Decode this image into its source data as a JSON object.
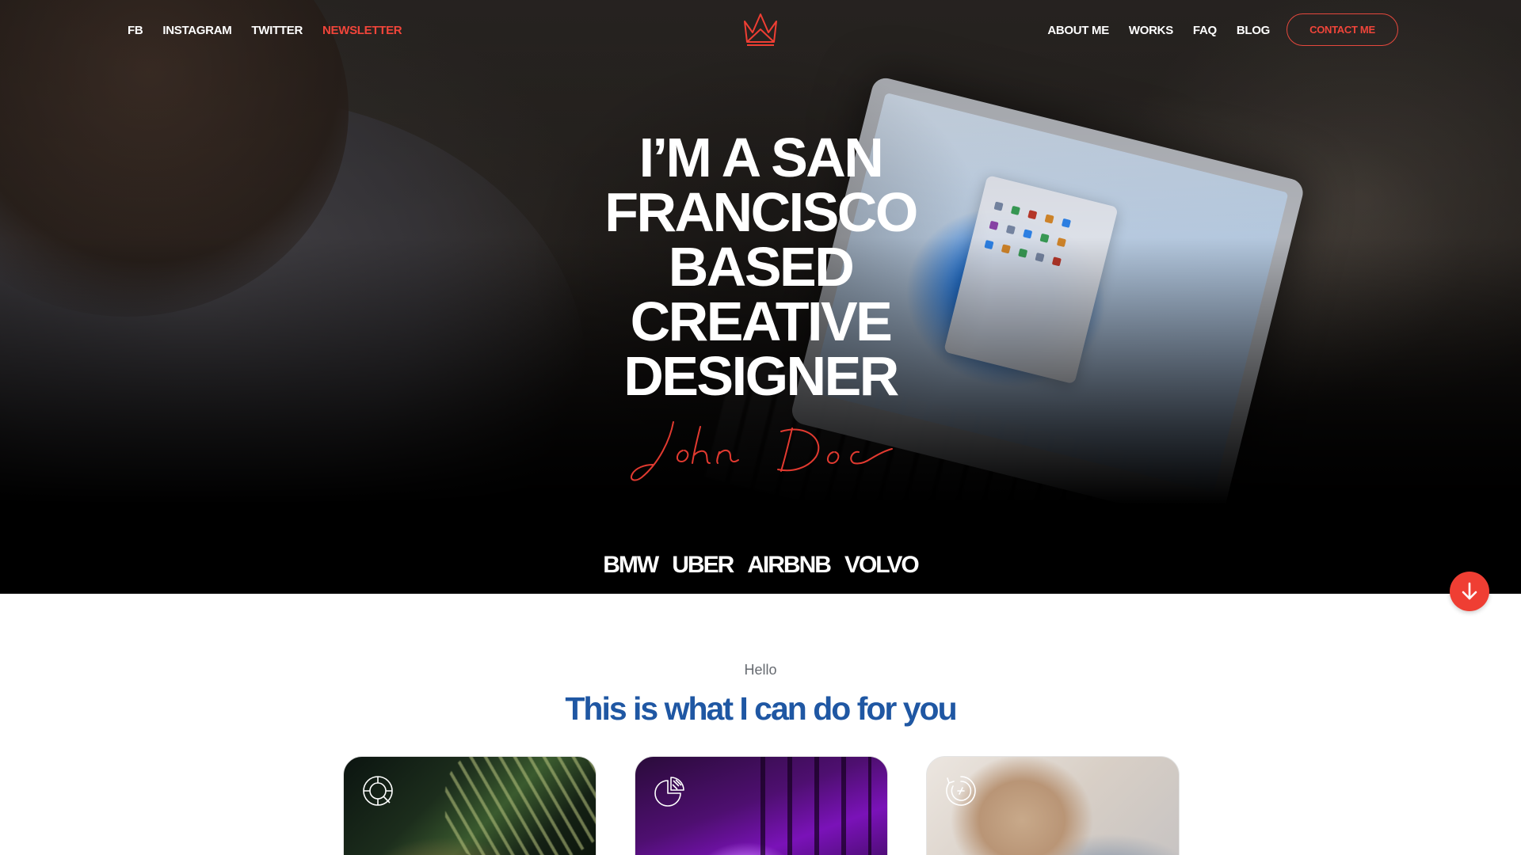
{
  "nav": {
    "left": [
      "FB",
      "INSTAGRAM",
      "TWITTER",
      "NEWSLETTER"
    ],
    "right": [
      "ABOUT ME",
      "WORKS",
      "FAQ",
      "BLOG"
    ],
    "contact_label": "CONTACT ME",
    "active_item": "NEWSLETTER"
  },
  "hero": {
    "headline": "I’M A SAN\nFRANCISCO\nBASED\nCREATIVE\nDESIGNER",
    "signature": "John Doe",
    "clients": [
      "BMW",
      "UBER",
      "AIRBNB",
      "VOLVO"
    ]
  },
  "services": {
    "kicker": "Hello",
    "title": "This is what I can do for you",
    "cards": [
      {
        "icon": "search-target-icon"
      },
      {
        "icon": "pie-chart-icon"
      },
      {
        "icon": "dial-icon"
      }
    ]
  },
  "colors": {
    "accent": "#ef3e33",
    "title_blue": "#1f57a3",
    "hero_background": "#000000",
    "text_white": "#ffffff"
  }
}
